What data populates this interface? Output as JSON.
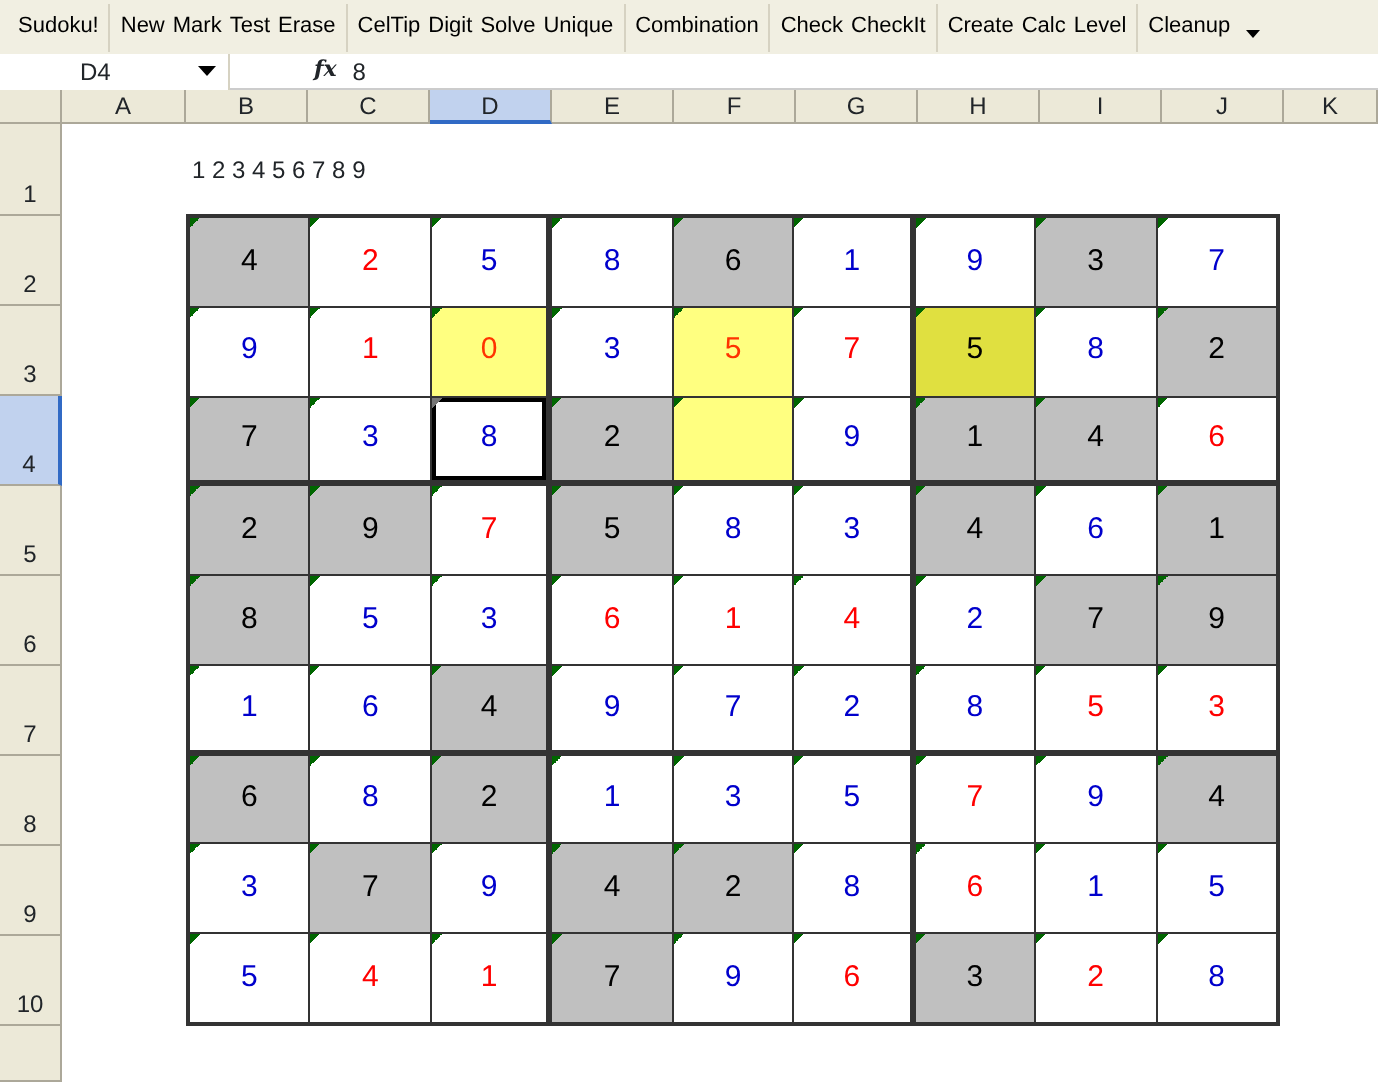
{
  "toolbar": {
    "groups": [
      [
        "Sudoku!"
      ],
      [
        "New",
        "Mark",
        "Test",
        "Erase"
      ],
      [
        "CelTip",
        "Digit",
        "Solve",
        "Unique"
      ],
      [
        "Combination"
      ],
      [
        "Check",
        "CheckIt"
      ],
      [
        "Create",
        "Calc",
        "Level"
      ],
      [
        "Cleanup"
      ]
    ]
  },
  "formula_bar": {
    "name_box": "D4",
    "fx": "fx",
    "value": "8"
  },
  "columns": [
    {
      "label": "A",
      "selected": false
    },
    {
      "label": "B",
      "selected": false
    },
    {
      "label": "C",
      "selected": false
    },
    {
      "label": "D",
      "selected": true
    },
    {
      "label": "E",
      "selected": false
    },
    {
      "label": "F",
      "selected": false
    },
    {
      "label": "G",
      "selected": false
    },
    {
      "label": "H",
      "selected": false
    },
    {
      "label": "I",
      "selected": false
    },
    {
      "label": "J",
      "selected": false
    },
    {
      "label": "K",
      "selected": false
    }
  ],
  "rows": [
    {
      "label": "1",
      "selected": false
    },
    {
      "label": "2",
      "selected": false
    },
    {
      "label": "3",
      "selected": false
    },
    {
      "label": "4",
      "selected": true
    },
    {
      "label": "5",
      "selected": false
    },
    {
      "label": "6",
      "selected": false
    },
    {
      "label": "7",
      "selected": false
    },
    {
      "label": "8",
      "selected": false
    },
    {
      "label": "9",
      "selected": false
    },
    {
      "label": "10",
      "selected": false
    }
  ],
  "digits_label": "1 2 3 4 5 6 7 8 9",
  "grid": [
    [
      {
        "v": "4",
        "kind": "given",
        "color": "#000000",
        "selected": false
      },
      {
        "v": "2",
        "kind": "open",
        "color": "#ff0000",
        "selected": false
      },
      {
        "v": "5",
        "kind": "open",
        "color": "#0000cc",
        "selected": false
      },
      {
        "v": "8",
        "kind": "open",
        "color": "#0000cc",
        "selected": false
      },
      {
        "v": "6",
        "kind": "given",
        "color": "#000000",
        "selected": false
      },
      {
        "v": "1",
        "kind": "open",
        "color": "#0000cc",
        "selected": false
      },
      {
        "v": "9",
        "kind": "open",
        "color": "#0000cc",
        "selected": false
      },
      {
        "v": "3",
        "kind": "given",
        "color": "#000000",
        "selected": false
      },
      {
        "v": "7",
        "kind": "open",
        "color": "#0000cc",
        "selected": false
      }
    ],
    [
      {
        "v": "9",
        "kind": "open",
        "color": "#0000cc",
        "selected": false
      },
      {
        "v": "1",
        "kind": "open",
        "color": "#ff0000",
        "selected": false
      },
      {
        "v": "0",
        "kind": "marked",
        "color": "#ff3300",
        "selected": false
      },
      {
        "v": "3",
        "kind": "open",
        "color": "#0000cc",
        "selected": false
      },
      {
        "v": "5",
        "kind": "marked",
        "color": "#ff3300",
        "selected": false
      },
      {
        "v": "7",
        "kind": "open",
        "color": "#ff0000",
        "selected": false
      },
      {
        "v": "5",
        "kind": "marked-dark",
        "color": "#000000",
        "selected": false
      },
      {
        "v": "8",
        "kind": "open",
        "color": "#0000cc",
        "selected": false
      },
      {
        "v": "2",
        "kind": "given",
        "color": "#000000",
        "selected": false
      }
    ],
    [
      {
        "v": "7",
        "kind": "given",
        "color": "#000000",
        "selected": false
      },
      {
        "v": "3",
        "kind": "open",
        "color": "#0000cc",
        "selected": false
      },
      {
        "v": "8",
        "kind": "open",
        "color": "#0000cc",
        "selected": true
      },
      {
        "v": "2",
        "kind": "given",
        "color": "#000000",
        "selected": false
      },
      {
        "kind": "marked",
        "selected": false
      },
      {
        "v": "9",
        "kind": "open",
        "color": "#0000cc",
        "selected": false
      },
      {
        "v": "1",
        "kind": "given",
        "color": "#000000",
        "selected": false
      },
      {
        "v": "4",
        "kind": "given",
        "color": "#000000",
        "selected": false
      },
      {
        "v": "6",
        "kind": "open",
        "color": "#ff0000",
        "selected": false
      }
    ],
    [
      {
        "v": "2",
        "kind": "given",
        "color": "#000000",
        "selected": false
      },
      {
        "v": "9",
        "kind": "given",
        "color": "#000000",
        "selected": false
      },
      {
        "v": "7",
        "kind": "open",
        "color": "#ff0000",
        "selected": false
      },
      {
        "v": "5",
        "kind": "given",
        "color": "#000000",
        "selected": false
      },
      {
        "v": "8",
        "kind": "open",
        "color": "#0000cc",
        "selected": false
      },
      {
        "v": "3",
        "kind": "open",
        "color": "#0000cc",
        "selected": false
      },
      {
        "v": "4",
        "kind": "given",
        "color": "#000000",
        "selected": false
      },
      {
        "v": "6",
        "kind": "open",
        "color": "#0000cc",
        "selected": false
      },
      {
        "v": "1",
        "kind": "given",
        "color": "#000000",
        "selected": false
      }
    ],
    [
      {
        "v": "8",
        "kind": "given",
        "color": "#000000",
        "selected": false
      },
      {
        "v": "5",
        "kind": "open",
        "color": "#0000cc",
        "selected": false
      },
      {
        "v": "3",
        "kind": "open",
        "color": "#0000cc",
        "selected": false
      },
      {
        "v": "6",
        "kind": "open",
        "color": "#ff0000",
        "selected": false
      },
      {
        "v": "1",
        "kind": "open",
        "color": "#ff0000",
        "selected": false
      },
      {
        "v": "4",
        "kind": "open",
        "color": "#ff0000",
        "selected": false
      },
      {
        "v": "2",
        "kind": "open",
        "color": "#0000cc",
        "selected": false
      },
      {
        "v": "7",
        "kind": "given",
        "color": "#000000",
        "selected": false
      },
      {
        "v": "9",
        "kind": "given",
        "color": "#000000",
        "selected": false
      }
    ],
    [
      {
        "v": "1",
        "kind": "open",
        "color": "#0000cc",
        "selected": false
      },
      {
        "v": "6",
        "kind": "open",
        "color": "#0000cc",
        "selected": false
      },
      {
        "v": "4",
        "kind": "given",
        "color": "#000000",
        "selected": false
      },
      {
        "v": "9",
        "kind": "open",
        "color": "#0000cc",
        "selected": false
      },
      {
        "v": "7",
        "kind": "open",
        "color": "#0000cc",
        "selected": false
      },
      {
        "v": "2",
        "kind": "open",
        "color": "#0000cc",
        "selected": false
      },
      {
        "v": "8",
        "kind": "open",
        "color": "#0000cc",
        "selected": false
      },
      {
        "v": "5",
        "kind": "open",
        "color": "#ff0000",
        "selected": false
      },
      {
        "v": "3",
        "kind": "open",
        "color": "#ff0000",
        "selected": false
      }
    ],
    [
      {
        "v": "6",
        "kind": "given",
        "color": "#000000",
        "selected": false
      },
      {
        "v": "8",
        "kind": "open",
        "color": "#0000cc",
        "selected": false
      },
      {
        "v": "2",
        "kind": "given",
        "color": "#000000",
        "selected": false
      },
      {
        "v": "1",
        "kind": "open",
        "color": "#0000cc",
        "selected": false
      },
      {
        "v": "3",
        "kind": "open",
        "color": "#0000cc",
        "selected": false
      },
      {
        "v": "5",
        "kind": "open",
        "color": "#0000cc",
        "selected": false
      },
      {
        "v": "7",
        "kind": "open",
        "color": "#ff0000",
        "selected": false
      },
      {
        "v": "9",
        "kind": "open",
        "color": "#0000cc",
        "selected": false
      },
      {
        "v": "4",
        "kind": "given",
        "color": "#000000",
        "selected": false
      }
    ],
    [
      {
        "v": "3",
        "kind": "open",
        "color": "#0000cc",
        "selected": false
      },
      {
        "v": "7",
        "kind": "given",
        "color": "#000000",
        "selected": false
      },
      {
        "v": "9",
        "kind": "open",
        "color": "#0000cc",
        "selected": false
      },
      {
        "v": "4",
        "kind": "given",
        "color": "#000000",
        "selected": false
      },
      {
        "v": "2",
        "kind": "given",
        "color": "#000000",
        "selected": false
      },
      {
        "v": "8",
        "kind": "open",
        "color": "#0000cc",
        "selected": false
      },
      {
        "v": "6",
        "kind": "open",
        "color": "#ff0000",
        "selected": false
      },
      {
        "v": "1",
        "kind": "open",
        "color": "#0000cc",
        "selected": false
      },
      {
        "v": "5",
        "kind": "open",
        "color": "#0000cc",
        "selected": false
      }
    ],
    [
      {
        "v": "5",
        "kind": "open",
        "color": "#0000cc",
        "selected": false
      },
      {
        "v": "4",
        "kind": "open",
        "color": "#ff0000",
        "selected": false
      },
      {
        "v": "1",
        "kind": "open",
        "color": "#ff0000",
        "selected": false
      },
      {
        "v": "7",
        "kind": "given",
        "color": "#000000",
        "selected": false
      },
      {
        "v": "9",
        "kind": "open",
        "color": "#0000cc",
        "selected": false
      },
      {
        "v": "6",
        "kind": "open",
        "color": "#ff0000",
        "selected": false
      },
      {
        "v": "3",
        "kind": "given",
        "color": "#000000",
        "selected": false
      },
      {
        "v": "2",
        "kind": "open",
        "color": "#ff0000",
        "selected": false
      },
      {
        "v": "8",
        "kind": "open",
        "color": "#0000cc",
        "selected": false
      }
    ]
  ]
}
